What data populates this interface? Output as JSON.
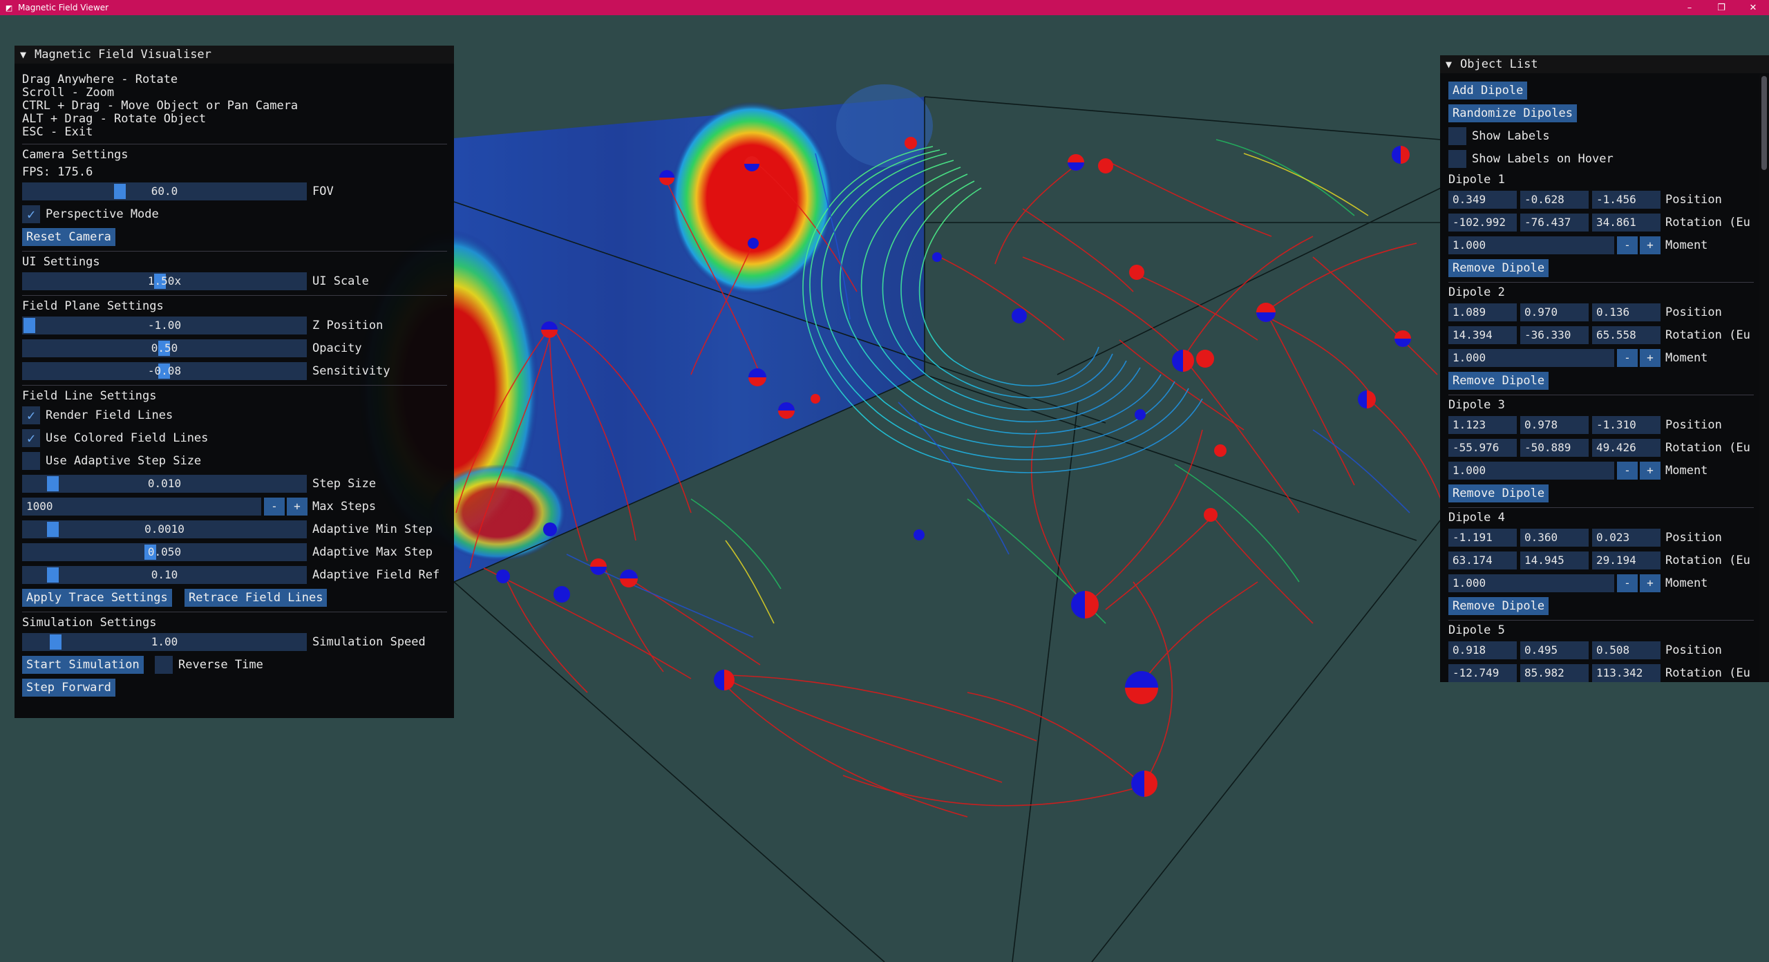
{
  "window": {
    "title": "Magnetic Field Viewer"
  },
  "left_panel": {
    "title": "Magnetic Field Visualiser",
    "help": [
      "Drag Anywhere - Rotate",
      "Scroll - Zoom",
      "CTRL + Drag - Move Object or Pan Camera",
      "ALT + Drag - Rotate Object",
      "ESC - Exit"
    ],
    "camera": {
      "header": "Camera Settings",
      "fps": "FPS: 175.6",
      "fov_value": "60.0",
      "fov_label": "FOV",
      "perspective_label": "Perspective Mode",
      "perspective_checked": true,
      "reset_label": "Reset Camera"
    },
    "ui": {
      "header": "UI Settings",
      "scale_value": "1.50x",
      "scale_label": "UI Scale"
    },
    "plane": {
      "header": "Field Plane Settings",
      "z_value": "-1.00",
      "z_label": "Z Position",
      "opacity_value": "0.50",
      "opacity_label": "Opacity",
      "sensitivity_value": "-0.08",
      "sensitivity_label": "Sensitivity"
    },
    "lines": {
      "header": "Field Line Settings",
      "render_label": "Render Field Lines",
      "render_checked": true,
      "colored_label": "Use Colored Field Lines",
      "colored_checked": true,
      "adaptive_label": "Use Adaptive Step Size",
      "adaptive_checked": false,
      "step_value": "0.010",
      "step_label": "Step Size",
      "max_steps_value": "1000",
      "max_steps_label": "Max Steps",
      "min_step_value": "0.0010",
      "min_step_label": "Adaptive Min Step",
      "max_step_value": "0.050",
      "max_step_label": "Adaptive Max Step",
      "ref_value": "0.10",
      "ref_label": "Adaptive Field Ref",
      "apply_label": "Apply Trace Settings",
      "retrace_label": "Retrace Field Lines"
    },
    "sim": {
      "header": "Simulation Settings",
      "speed_value": "1.00",
      "speed_label": "Simulation Speed",
      "start_label": "Start Simulation",
      "reverse_label": "Reverse Time",
      "reverse_checked": false,
      "step_label": "Step Forward"
    },
    "minus": "-",
    "plus": "+"
  },
  "right_panel": {
    "title": "Object List",
    "add_label": "Add Dipole",
    "randomize_label": "Randomize Dipoles",
    "show_labels": "Show Labels",
    "show_labels_hover": "Show Labels on Hover",
    "position_label": "Position",
    "rotation_label": "Rotation (Eu",
    "moment_label": "Moment",
    "remove_label": "Remove Dipole",
    "dipoles": [
      {
        "name": "Dipole 1",
        "pos": [
          "0.349",
          "-0.628",
          "-1.456"
        ],
        "rot": [
          "-102.992",
          "-76.437",
          "34.861"
        ],
        "moment": "1.000"
      },
      {
        "name": "Dipole 2",
        "pos": [
          "1.089",
          "0.970",
          "0.136"
        ],
        "rot": [
          "14.394",
          "-36.330",
          "65.558"
        ],
        "moment": "1.000"
      },
      {
        "name": "Dipole 3",
        "pos": [
          "1.123",
          "0.978",
          "-1.310"
        ],
        "rot": [
          "-55.976",
          "-50.889",
          "49.426"
        ],
        "moment": "1.000"
      },
      {
        "name": "Dipole 4",
        "pos": [
          "-1.191",
          "0.360",
          "0.023"
        ],
        "rot": [
          "63.174",
          "14.945",
          "29.194"
        ],
        "moment": "1.000"
      },
      {
        "name": "Dipole 5",
        "pos": [
          "0.918",
          "0.495",
          "0.508"
        ],
        "rot": [
          "-12.749",
          "85.982",
          "113.342"
        ]
      }
    ]
  }
}
